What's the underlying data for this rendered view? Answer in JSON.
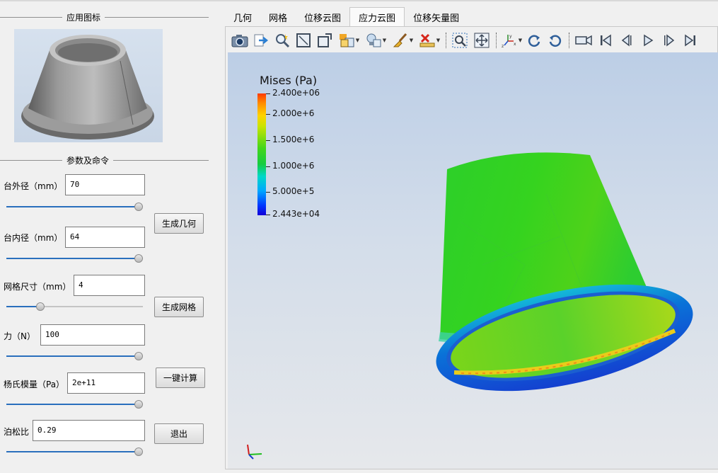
{
  "left_panel": {
    "icon_group_title": "应用图标",
    "params_group_title": "参数及命令",
    "params": [
      {
        "label": "台外径（mm）",
        "value": "70",
        "slider": 1.0
      },
      {
        "label": "台内径（mm）",
        "value": "64",
        "slider": 1.0
      },
      {
        "label": "网格尺寸（mm）",
        "value": "4",
        "slider": 0.25
      },
      {
        "label": "力（N）",
        "value": "100",
        "slider": 1.0
      },
      {
        "label": "杨氏模量（Pa）",
        "value": "2e+11",
        "slider": 1.0
      },
      {
        "label": "泊松比",
        "value": "0.29",
        "slider": 1.0
      }
    ],
    "buttons": {
      "gen_geometry": "生成几何",
      "gen_mesh": "生成网格",
      "compute": "一键计算",
      "exit": "退出"
    }
  },
  "tabs": [
    "几何",
    "网格",
    "位移云图",
    "应力云图",
    "位移矢量图"
  ],
  "active_tab": "应力云图",
  "toolbar_icons": [
    "camera-icon",
    "export-icon",
    "magic-select-icon",
    "frame-icon",
    "box-icon",
    "display-style-icon",
    "light-bulb-icon",
    "clear-brush-icon",
    "delete-ruler-icon",
    "zoom-box-icon",
    "fit-view-icon",
    "axes-icon",
    "rotate-cw-icon",
    "rotate-ccw-icon",
    "video-camera-icon",
    "first-frame-icon",
    "prev-frame-icon",
    "play-icon",
    "next-frame-icon",
    "last-frame-icon"
  ],
  "legend": {
    "title": "Mises (Pa)",
    "max": "2.400e+06",
    "labels": [
      "2.000e+6",
      "1.500e+6",
      "1.000e+6",
      "5.000e+5"
    ],
    "min": "2.443e+04",
    "colors": {
      "max": "#ff3a00",
      "mid": "#22d01b",
      "min": "#1300d8"
    }
  }
}
